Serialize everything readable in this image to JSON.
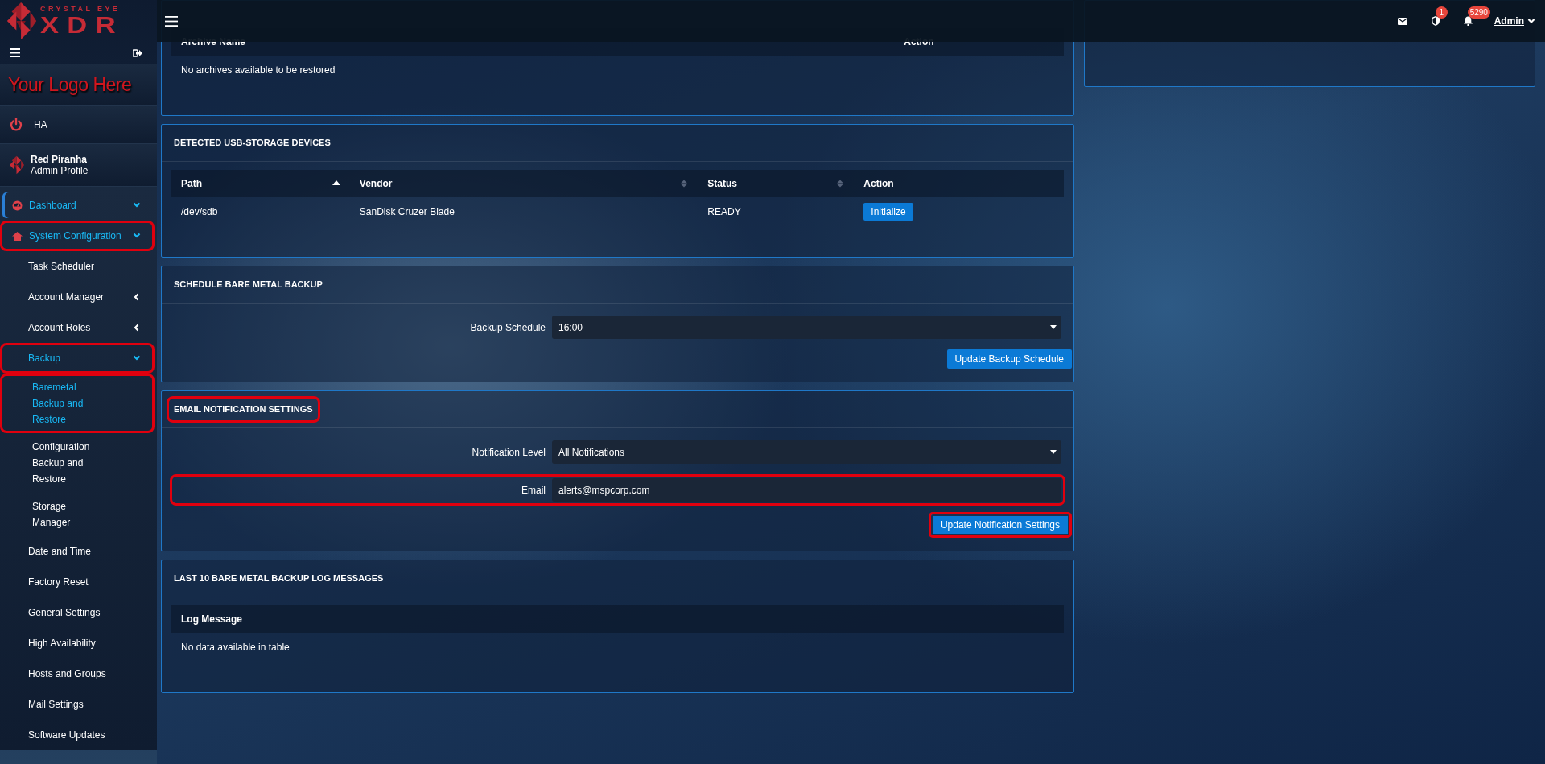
{
  "sidebar": {
    "brand": {
      "tagline": "CRYSTAL EYE",
      "wordmark": "XDR"
    },
    "custom_logo": "Your Logo Here",
    "ha": {
      "label": "HA"
    },
    "profile": {
      "name": "Red Piranha",
      "role": "Admin Profile"
    },
    "items": [
      {
        "label": "Dashboard",
        "expanded": true,
        "active": true,
        "highlighted": false
      },
      {
        "label": "System Configuration",
        "expanded": true,
        "active": true,
        "highlighted": true,
        "children": [
          {
            "label": "Task Scheduler",
            "active": false,
            "highlighted": false
          },
          {
            "label": "Account Manager",
            "expanded": false,
            "active": false,
            "highlighted": false
          },
          {
            "label": "Account Roles",
            "expanded": false,
            "active": false,
            "highlighted": false
          },
          {
            "label": "Backup",
            "expanded": true,
            "active": true,
            "highlighted": true,
            "children": [
              {
                "label": "Baremetal Backup and Restore",
                "active": true,
                "highlighted": true
              },
              {
                "label": "Configuration Backup and Restore",
                "active": false,
                "highlighted": false
              },
              {
                "label": "Storage Manager",
                "active": false,
                "highlighted": false
              }
            ]
          },
          {
            "label": "Date and Time",
            "active": false,
            "highlighted": false
          },
          {
            "label": "Factory Reset",
            "active": false,
            "highlighted": false
          },
          {
            "label": "General Settings",
            "active": false,
            "highlighted": false
          },
          {
            "label": "High Availability",
            "active": false,
            "highlighted": false
          },
          {
            "label": "Hosts and Groups",
            "active": false,
            "highlighted": false
          },
          {
            "label": "Mail Settings",
            "active": false,
            "highlighted": false
          },
          {
            "label": "Software Updates",
            "active": false,
            "highlighted": false
          }
        ]
      }
    ]
  },
  "topbar": {
    "indicators": [
      {
        "kind": "mail"
      },
      {
        "kind": "shield",
        "badge": "1"
      },
      {
        "kind": "bell",
        "badge": "5290"
      }
    ],
    "user": "Admin"
  },
  "panels": [
    {
      "kind": "table",
      "columns": [
        {
          "label": "Archive Name"
        },
        {
          "label": "Action"
        }
      ],
      "empty_text": "No archives available to be restored"
    },
    {
      "kind": "table",
      "title": "DETECTED USB-STORAGE DEVICES",
      "highlighted": false,
      "columns": [
        {
          "label": "Path",
          "sortable": true,
          "sorted": true
        },
        {
          "label": "Vendor",
          "sortable": true,
          "sorted": false
        },
        {
          "label": "Status",
          "sortable": true,
          "sorted": false
        },
        {
          "label": "Action"
        }
      ],
      "rows": [
        {
          "cells": [
            "/dev/sdb",
            "SanDisk Cruzer Blade",
            "READY"
          ],
          "action": "Initialize"
        }
      ]
    },
    {
      "kind": "form",
      "title": "SCHEDULE BARE METAL BACKUP",
      "highlighted": false,
      "fields": [
        {
          "kind": "select",
          "label": "Backup Schedule",
          "value": "16:00",
          "highlighted": false
        }
      ],
      "button": {
        "label": "Update Backup Schedule",
        "highlighted": false
      }
    },
    {
      "kind": "form",
      "title": "EMAIL NOTIFICATION SETTINGS",
      "highlighted": true,
      "fields": [
        {
          "kind": "select",
          "label": "Notification Level",
          "value": "All Notifications",
          "highlighted": false
        },
        {
          "kind": "input",
          "label": "Email",
          "value": "alerts@mspcorp.com",
          "highlighted": true
        }
      ],
      "button": {
        "label": "Update Notification Settings",
        "highlighted": true
      }
    },
    {
      "kind": "table",
      "title": "LAST 10 BARE METAL BACKUP LOG MESSAGES",
      "highlighted": false,
      "columns": [
        {
          "label": "Log Message"
        }
      ],
      "empty_text": "No data available in table"
    }
  ]
}
